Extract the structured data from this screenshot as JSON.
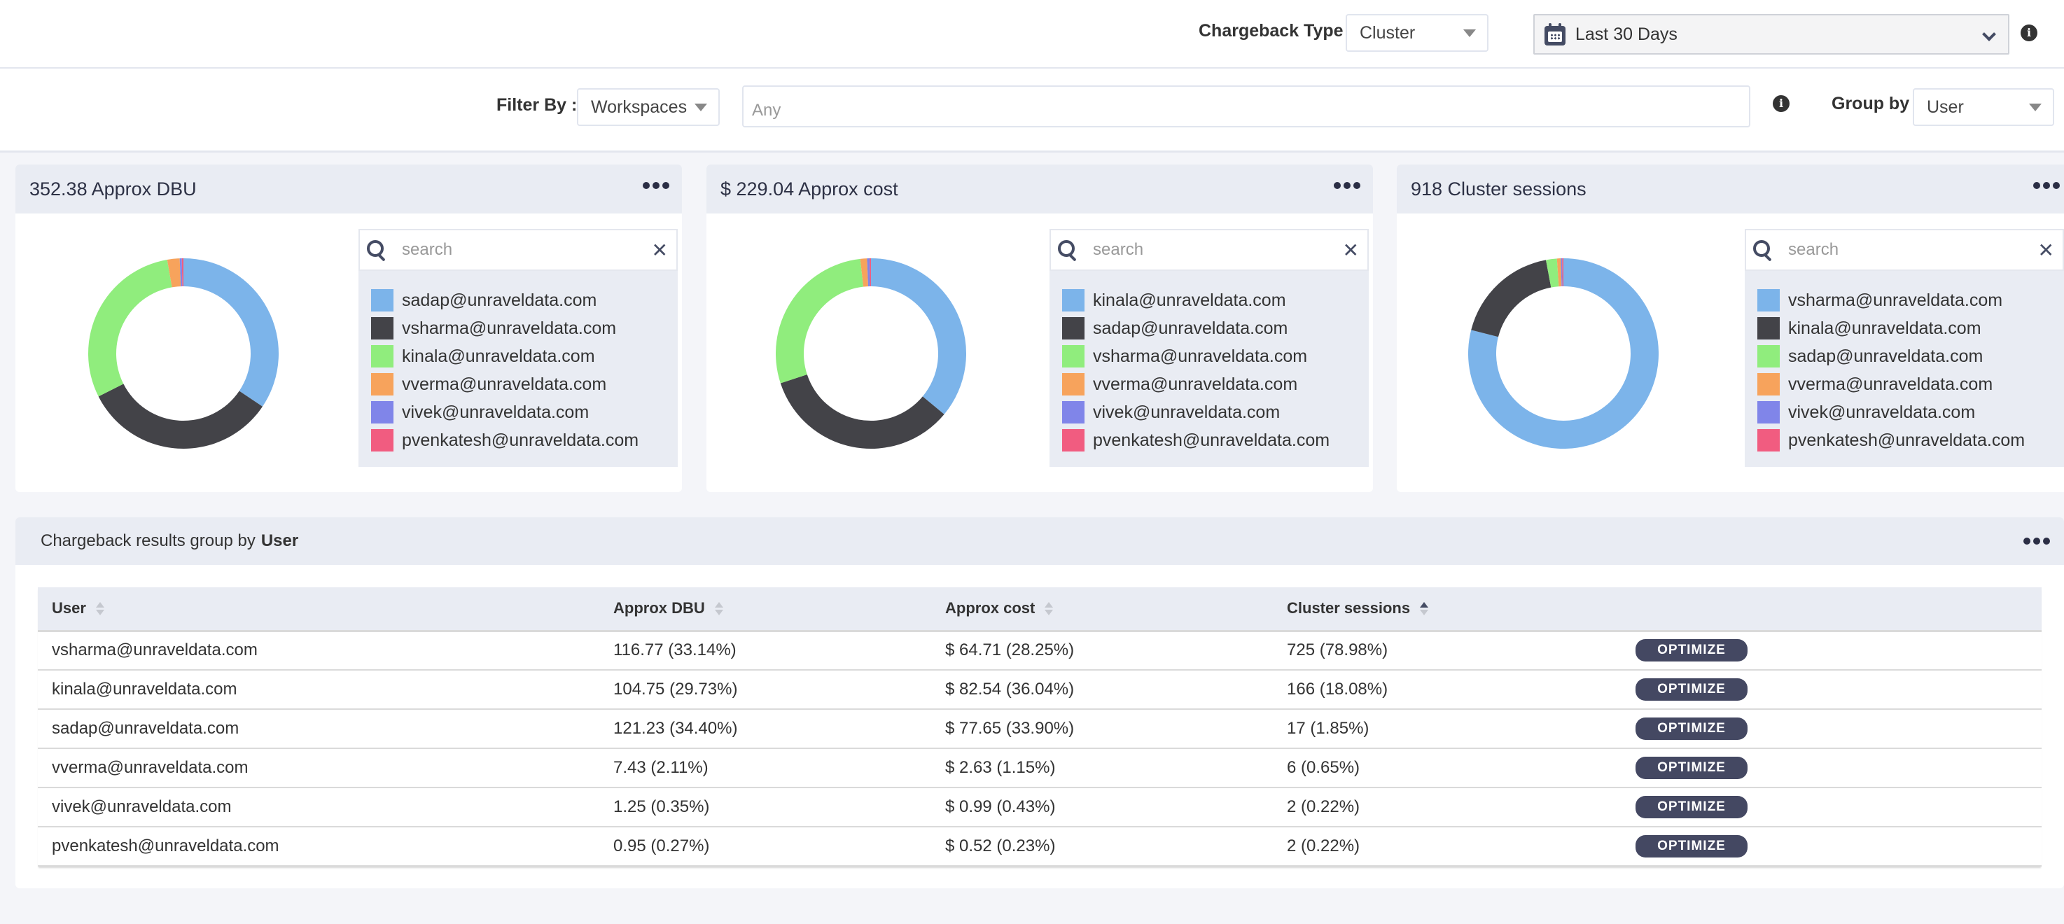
{
  "topbar": {
    "chargeback_type_label": "Chargeback Type",
    "chargeback_type_value": "Cluster",
    "date_range": "Last 30 Days"
  },
  "filterbar": {
    "filter_by_label": "Filter By :",
    "filter_by_value": "Workspaces",
    "filter_placeholder": "Any",
    "group_by_label": "Group by",
    "group_by_value": "User"
  },
  "icons": {
    "info": "i",
    "close": "✕"
  },
  "colors": {
    "blue": "#7cb4ea",
    "dark": "#434348",
    "green": "#90ed7d",
    "orange": "#f7a35c",
    "purple": "#8085e9",
    "pink": "#f15c80",
    "button": "#444862",
    "header_bg": "#e9ecf3"
  },
  "cards": [
    {
      "title": "352.38 Approx DBU",
      "search_placeholder": "search",
      "legend": [
        {
          "label": "sadap@unraveldata.com",
          "color": "#7cb4ea"
        },
        {
          "label": "vsharma@unraveldata.com",
          "color": "#434348"
        },
        {
          "label": "kinala@unraveldata.com",
          "color": "#90ed7d"
        },
        {
          "label": "vverma@unraveldata.com",
          "color": "#f7a35c"
        },
        {
          "label": "vivek@unraveldata.com",
          "color": "#8085e9"
        },
        {
          "label": "pvenkatesh@unraveldata.com",
          "color": "#f15c80"
        }
      ]
    },
    {
      "title": "$ 229.04 Approx cost",
      "search_placeholder": "search",
      "legend": [
        {
          "label": "kinala@unraveldata.com",
          "color": "#7cb4ea"
        },
        {
          "label": "sadap@unraveldata.com",
          "color": "#434348"
        },
        {
          "label": "vsharma@unraveldata.com",
          "color": "#90ed7d"
        },
        {
          "label": "vverma@unraveldata.com",
          "color": "#f7a35c"
        },
        {
          "label": "vivek@unraveldata.com",
          "color": "#8085e9"
        },
        {
          "label": "pvenkatesh@unraveldata.com",
          "color": "#f15c80"
        }
      ]
    },
    {
      "title": "918 Cluster sessions",
      "search_placeholder": "search",
      "legend": [
        {
          "label": "vsharma@unraveldata.com",
          "color": "#7cb4ea"
        },
        {
          "label": "kinala@unraveldata.com",
          "color": "#434348"
        },
        {
          "label": "sadap@unraveldata.com",
          "color": "#90ed7d"
        },
        {
          "label": "vverma@unraveldata.com",
          "color": "#f7a35c"
        },
        {
          "label": "vivek@unraveldata.com",
          "color": "#8085e9"
        },
        {
          "label": "pvenkatesh@unraveldata.com",
          "color": "#f15c80"
        }
      ]
    }
  ],
  "chart_data": [
    {
      "type": "pie",
      "title": "352.38 Approx DBU",
      "categories": [
        "sadap@unraveldata.com",
        "vsharma@unraveldata.com",
        "kinala@unraveldata.com",
        "vverma@unraveldata.com",
        "vivek@unraveldata.com",
        "pvenkatesh@unraveldata.com"
      ],
      "values": [
        121.23,
        116.77,
        104.75,
        7.43,
        1.25,
        0.95
      ],
      "colors": [
        "#7cb4ea",
        "#434348",
        "#90ed7d",
        "#f7a35c",
        "#8085e9",
        "#f15c80"
      ],
      "donut": true,
      "legend": "right"
    },
    {
      "type": "pie",
      "title": "$ 229.04 Approx cost",
      "categories": [
        "kinala@unraveldata.com",
        "sadap@unraveldata.com",
        "vsharma@unraveldata.com",
        "vverma@unraveldata.com",
        "vivek@unraveldata.com",
        "pvenkatesh@unraveldata.com"
      ],
      "values": [
        82.54,
        77.65,
        64.71,
        2.63,
        0.99,
        0.52
      ],
      "colors": [
        "#7cb4ea",
        "#434348",
        "#90ed7d",
        "#f7a35c",
        "#8085e9",
        "#f15c80"
      ],
      "donut": true,
      "legend": "right"
    },
    {
      "type": "pie",
      "title": "918 Cluster sessions",
      "categories": [
        "vsharma@unraveldata.com",
        "kinala@unraveldata.com",
        "sadap@unraveldata.com",
        "vverma@unraveldata.com",
        "vivek@unraveldata.com",
        "pvenkatesh@unraveldata.com"
      ],
      "values": [
        725,
        166,
        17,
        6,
        2,
        2
      ],
      "colors": [
        "#7cb4ea",
        "#434348",
        "#90ed7d",
        "#f7a35c",
        "#8085e9",
        "#f15c80"
      ],
      "donut": true,
      "legend": "right"
    }
  ],
  "results": {
    "title_prefix": "Chargeback results group by",
    "title_group": "User",
    "columns": [
      "User",
      "Approx DBU",
      "Approx cost",
      "Cluster sessions"
    ],
    "sort_column": "Cluster sessions",
    "sort_direction": "ascending",
    "action_label": "OPTIMIZE",
    "rows": [
      {
        "user": "vsharma@unraveldata.com",
        "dbu": "116.77 (33.14%)",
        "cost": "$ 64.71 (28.25%)",
        "sessions": "725 (78.98%)"
      },
      {
        "user": "kinala@unraveldata.com",
        "dbu": "104.75 (29.73%)",
        "cost": "$ 82.54 (36.04%)",
        "sessions": "166 (18.08%)"
      },
      {
        "user": "sadap@unraveldata.com",
        "dbu": "121.23 (34.40%)",
        "cost": "$ 77.65 (33.90%)",
        "sessions": "17 (1.85%)"
      },
      {
        "user": "vverma@unraveldata.com",
        "dbu": "7.43 (2.11%)",
        "cost": "$ 2.63 (1.15%)",
        "sessions": "6 (0.65%)"
      },
      {
        "user": "vivek@unraveldata.com",
        "dbu": "1.25 (0.35%)",
        "cost": "$ 0.99 (0.43%)",
        "sessions": "2 (0.22%)"
      },
      {
        "user": "pvenkatesh@unraveldata.com",
        "dbu": "0.95 (0.27%)",
        "cost": "$ 0.52 (0.23%)",
        "sessions": "2 (0.22%)"
      }
    ]
  }
}
